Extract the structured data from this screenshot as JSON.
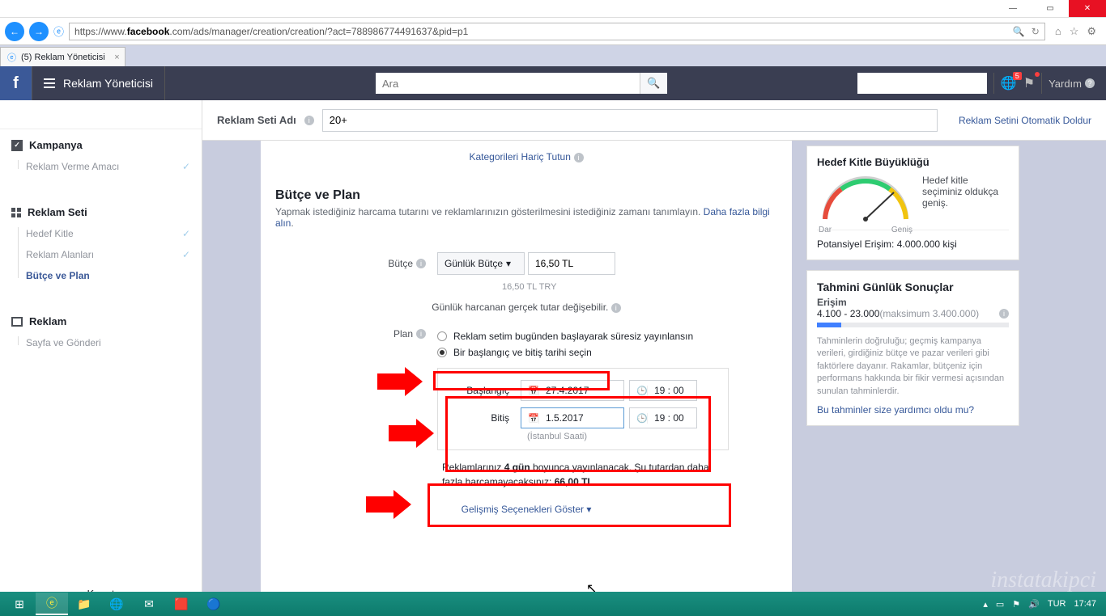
{
  "window": {
    "minimize": "—",
    "maximize": "▭",
    "close": "✕"
  },
  "browser": {
    "url_pre": "https://www.",
    "url_domain": "facebook",
    "url_post": ".com/ads/manager/creation/creation/?act=788986774491637&pid=p1",
    "tab_title": "(5) Reklam Yöneticisi"
  },
  "fbbar": {
    "title": "Reklam Yöneticisi",
    "search_placeholder": "Ara",
    "badge": "5",
    "help": "Yardım"
  },
  "adset_bar": {
    "label": "Reklam Seti Adı",
    "value": "20+",
    "autofill": "Reklam Setini Otomatik Doldur"
  },
  "sidebar": {
    "campaign": {
      "title": "Kampanya",
      "item1": "Reklam Verme Amacı"
    },
    "adset": {
      "title": "Reklam Seti",
      "item1": "Hedef Kitle",
      "item2": "Reklam Alanları",
      "item3": "Bütçe ve Plan"
    },
    "ad": {
      "title": "Reklam",
      "item1": "Sayfa ve Gönderi"
    },
    "close": "Kapat"
  },
  "main": {
    "exclude_link": "Kategorileri Hariç Tutun",
    "section_title": "Bütçe ve Plan",
    "section_desc": "Yapmak istediğiniz harcama tutarını ve reklamlarınızın gösterilmesini istediğiniz zamanı tanımlayın. ",
    "more_link": "Daha fazla bilgi alın",
    "budget_label": "Bütçe",
    "budget_type": "Günlük Bütçe",
    "budget_value": "16,50 TL",
    "budget_try": "16,50 TL TRY",
    "budget_hint": "Günlük harcanan gerçek tutar değişebilir.",
    "plan_label": "Plan",
    "radio1": "Reklam setim bugünden başlayarak süresiz yayınlansın",
    "radio2": "Bir başlangıç ve bitiş tarihi seçin",
    "start_label": "Başlangıç",
    "end_label": "Bitiş",
    "start_date": "27.4.2017",
    "start_time": "19 : 00",
    "end_date": "1.5.2017",
    "end_time": "19 : 00",
    "tz": "(İstanbul Saati)",
    "summary_pre": "Reklamlarınız ",
    "summary_days": "4 gün",
    "summary_mid": " boyunca yayınlanacak. Şu tutardan daha fazla harcamayacaksınız: ",
    "summary_amount": "66,00 TL",
    "adv": "Gelişmiş Seçenekleri Göster"
  },
  "right": {
    "audience_title": "Hedef Kitle Büyüklüğü",
    "audience_desc": "Hedef kitle seçiminiz oldukça geniş.",
    "gauge_left": "Dar",
    "gauge_right": "Geniş",
    "reach": "Potansiyel Erişim: 4.000.000 kişi",
    "est_title": "Tahmini Günlük Sonuçlar",
    "est_sub": "Erişim",
    "est_range": "4.100 - 23.000",
    "est_max": " (maksimum 3.400.000)",
    "est_desc": "Tahminlerin doğruluğu; geçmiş kampanya verileri, girdiğiniz bütçe ve pazar verileri gibi faktörlere dayanır. Rakamlar, bütçeniz için performans hakkında bir fikir vermesi açısından sunulan tahminlerdir.",
    "est_link": "Bu tahminler size yardımcı oldu mu?"
  },
  "taskbar": {
    "lang": "TUR",
    "time": "17:47"
  }
}
